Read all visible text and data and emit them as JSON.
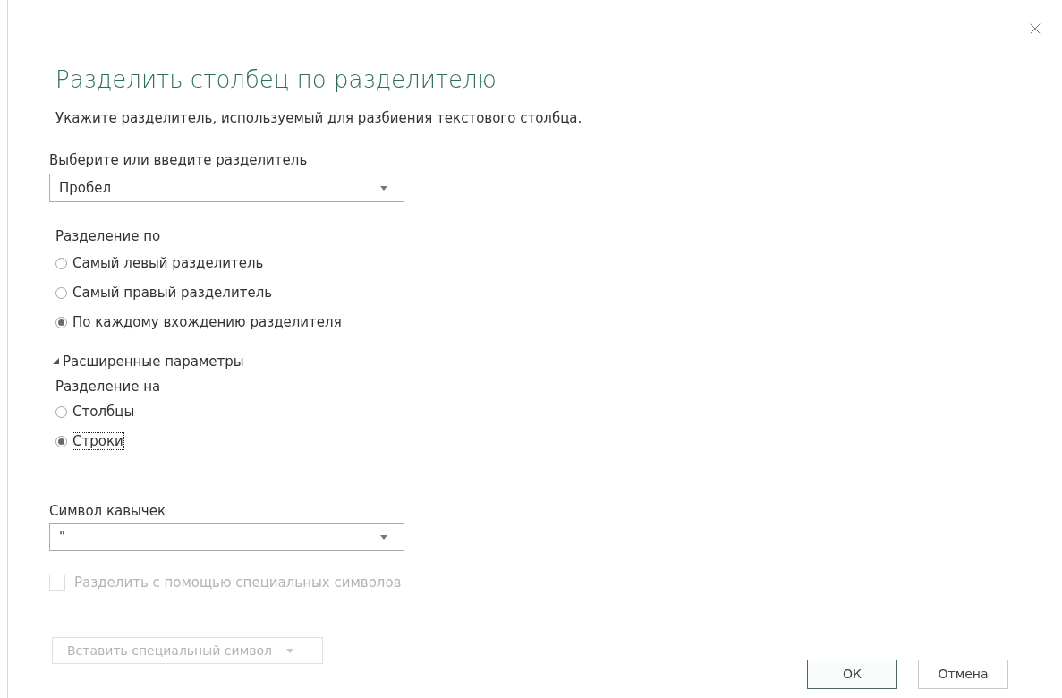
{
  "dialog": {
    "title": "Разделить столбец по разделителю",
    "description": "Укажите разделитель, используемый для разбиения текстового столбца."
  },
  "delimiter": {
    "label": "Выберите или введите разделитель",
    "value": "Пробел"
  },
  "split_at": {
    "label": "Разделение по",
    "options": [
      {
        "label": "Самый левый разделитель",
        "selected": false
      },
      {
        "label": "Самый правый разделитель",
        "selected": false
      },
      {
        "label": "По каждому вхождению разделителя",
        "selected": true
      }
    ]
  },
  "advanced": {
    "label": "Расширенные параметры",
    "expanded": true
  },
  "split_into": {
    "label": "Разделение на",
    "options": [
      {
        "label": "Столбцы",
        "selected": false,
        "focused": false
      },
      {
        "label": "Строки",
        "selected": true,
        "focused": true
      }
    ]
  },
  "quote": {
    "label": "Символ кавычек",
    "value": "\""
  },
  "special_chars": {
    "label": "Разделить с помощью специальных символов",
    "checked": false,
    "disabled": true
  },
  "insert_button": {
    "label": "Вставить специальный символ",
    "disabled": true
  },
  "buttons": [
    {
      "label": "ОК",
      "kind": "primary"
    },
    {
      "label": "Отмена",
      "kind": "secondary"
    }
  ]
}
